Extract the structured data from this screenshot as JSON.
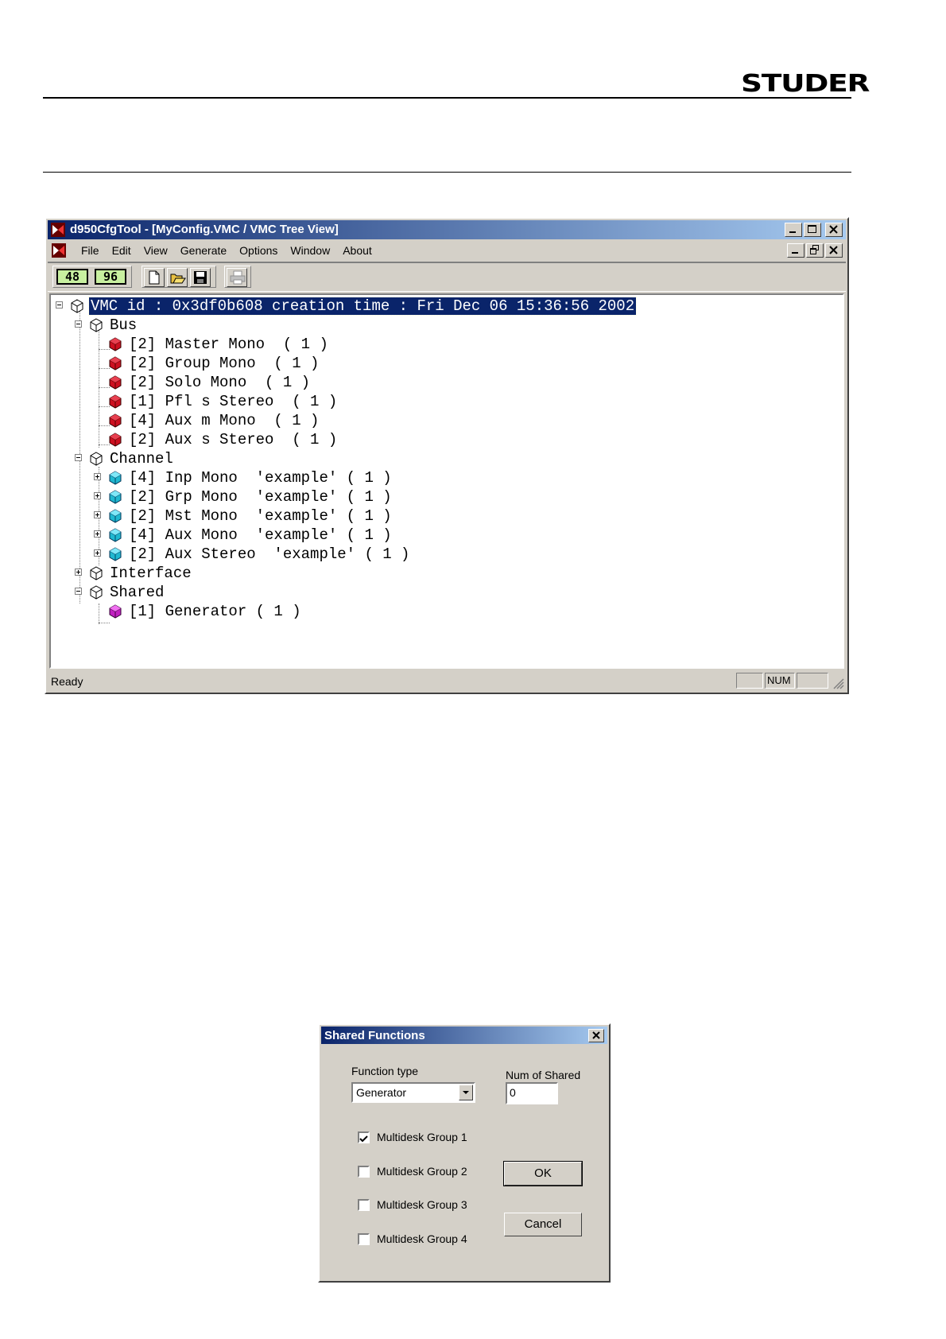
{
  "page": {
    "brand": "STUDER"
  },
  "app": {
    "title": "d950CfgTool - [MyConfig.VMC / VMC Tree View]",
    "menus": [
      "File",
      "Edit",
      "View",
      "Generate",
      "Options",
      "Window",
      "About"
    ],
    "toolbar": {
      "rate_48": "48",
      "rate_96": "96"
    },
    "tree": {
      "root": "VMC id : 0x3df0b608 creation time : Fri Dec 06 15:36:56 2002",
      "groups": {
        "bus": "Bus",
        "channel": "Channel",
        "interface": "Interface",
        "shared": "Shared"
      },
      "bus_items": [
        "[2] Master Mono  ( 1 )",
        "[2] Group Mono  ( 1 )",
        "[2] Solo Mono  ( 1 )",
        "[1] Pfl s Stereo  ( 1 )",
        "[4] Aux m Mono  ( 1 )",
        "[2] Aux s Stereo  ( 1 )"
      ],
      "channel_items": [
        "[4] Inp Mono  'example' ( 1 )",
        "[2] Grp Mono  'example' ( 1 )",
        "[2] Mst Mono  'example' ( 1 )",
        "[4] Aux Mono  'example' ( 1 )",
        "[2] Aux Stereo  'example' ( 1 )"
      ],
      "shared_items": [
        "[1] Generator ( 1 )"
      ]
    },
    "status": {
      "text": "Ready",
      "num": "NUM"
    }
  },
  "dialog": {
    "title": "Shared Functions",
    "function_type_label": "Function type",
    "function_type_value": "Generator",
    "num_shared_label": "Num of Shared",
    "num_shared_value": "0",
    "groups": [
      {
        "label": "Multidesk Group 1",
        "checked": true
      },
      {
        "label": "Multidesk Group 2",
        "checked": false
      },
      {
        "label": "Multidesk Group 3",
        "checked": false
      },
      {
        "label": "Multidesk Group 4",
        "checked": false
      }
    ],
    "ok_label": "OK",
    "cancel_label": "Cancel"
  },
  "colors": {
    "bus_icon": "#cc1020",
    "channel_icon": "#20b8d0",
    "shared_icon": "#c020c0",
    "titlebar": "#0a246a"
  }
}
